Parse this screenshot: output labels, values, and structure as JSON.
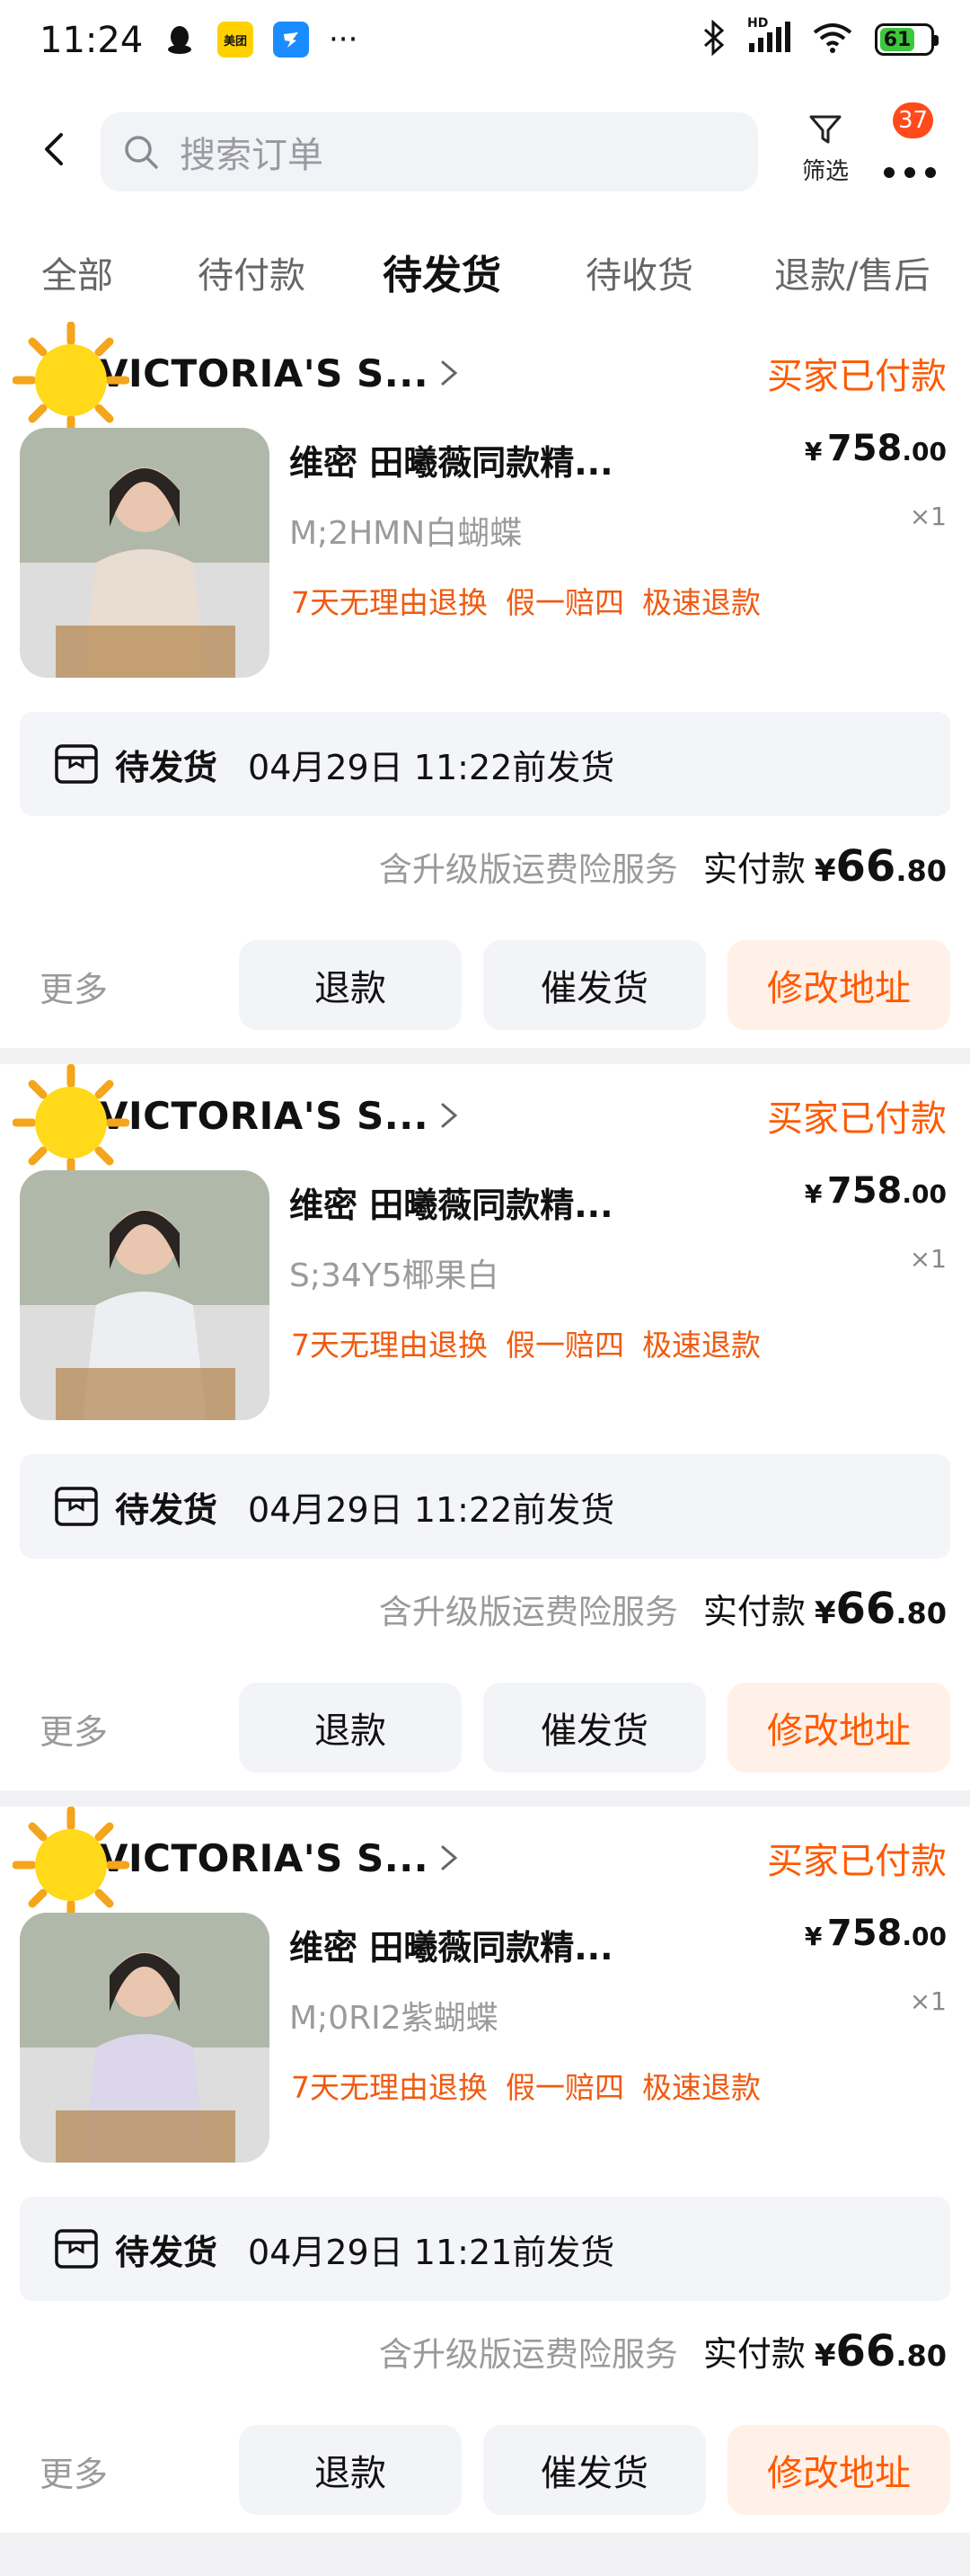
{
  "status_bar": {
    "time": "11:24",
    "app_icons": [
      "qq-penguin-icon",
      "meituan-icon",
      "dingtalk-icon"
    ],
    "overflow": "···",
    "network_label": "HD",
    "battery": "61"
  },
  "header": {
    "search_placeholder": "搜索订单",
    "filter_label": "筛选",
    "more_badge": "37"
  },
  "tabs": [
    {
      "label": "全部",
      "active": false
    },
    {
      "label": "待付款",
      "active": false
    },
    {
      "label": "待发货",
      "active": true
    },
    {
      "label": "待收货",
      "active": false
    },
    {
      "label": "退款/售后",
      "active": false
    }
  ],
  "orders": [
    {
      "shop": "VICTORIA'S S...",
      "status": "买家已付款",
      "title": "维密 田曦薇同款精...",
      "price_currency": "¥",
      "price_int": "758",
      "price_dec": ".00",
      "qty": "×1",
      "sku": "M;2HMN白蝴蝶",
      "tags": [
        "7天无理由退换",
        "假一赔四",
        "极速退款"
      ],
      "ship_status": "待发货",
      "ship_time": "04月29日 11:22前发货",
      "service": "含升级版运费险服务",
      "paid_label": "实付款",
      "paid_currency": "¥",
      "paid_int": "66",
      "paid_dec": ".80",
      "more": "更多",
      "btn_refund": "退款",
      "btn_urge": "催发货",
      "btn_address": "修改地址",
      "photo_color": "#e9dcd0"
    },
    {
      "shop": "VICTORIA'S S...",
      "status": "买家已付款",
      "title": "维密 田曦薇同款精...",
      "price_currency": "¥",
      "price_int": "758",
      "price_dec": ".00",
      "qty": "×1",
      "sku": "S;34Y5椰果白",
      "tags": [
        "7天无理由退换",
        "假一赔四",
        "极速退款"
      ],
      "ship_status": "待发货",
      "ship_time": "04月29日 11:22前发货",
      "service": "含升级版运费险服务",
      "paid_label": "实付款",
      "paid_currency": "¥",
      "paid_int": "66",
      "paid_dec": ".80",
      "more": "更多",
      "btn_refund": "退款",
      "btn_urge": "催发货",
      "btn_address": "修改地址",
      "photo_color": "#eceef2"
    },
    {
      "shop": "VICTORIA'S S...",
      "status": "买家已付款",
      "title": "维密 田曦薇同款精...",
      "price_currency": "¥",
      "price_int": "758",
      "price_dec": ".00",
      "qty": "×1",
      "sku": "M;0RI2紫蝴蝶",
      "tags": [
        "7天无理由退换",
        "假一赔四",
        "极速退款"
      ],
      "ship_status": "待发货",
      "ship_time": "04月29日 11:21前发货",
      "service": "含升级版运费险服务",
      "paid_label": "实付款",
      "paid_currency": "¥",
      "paid_int": "66",
      "paid_dec": ".80",
      "more": "更多",
      "btn_refund": "退款",
      "btn_urge": "催发货",
      "btn_address": "修改地址",
      "photo_color": "#dcd6ea"
    }
  ],
  "colors": {
    "accent": "#ff5a00",
    "badge": "#ff4a1c",
    "battery": "#3ec73e"
  }
}
